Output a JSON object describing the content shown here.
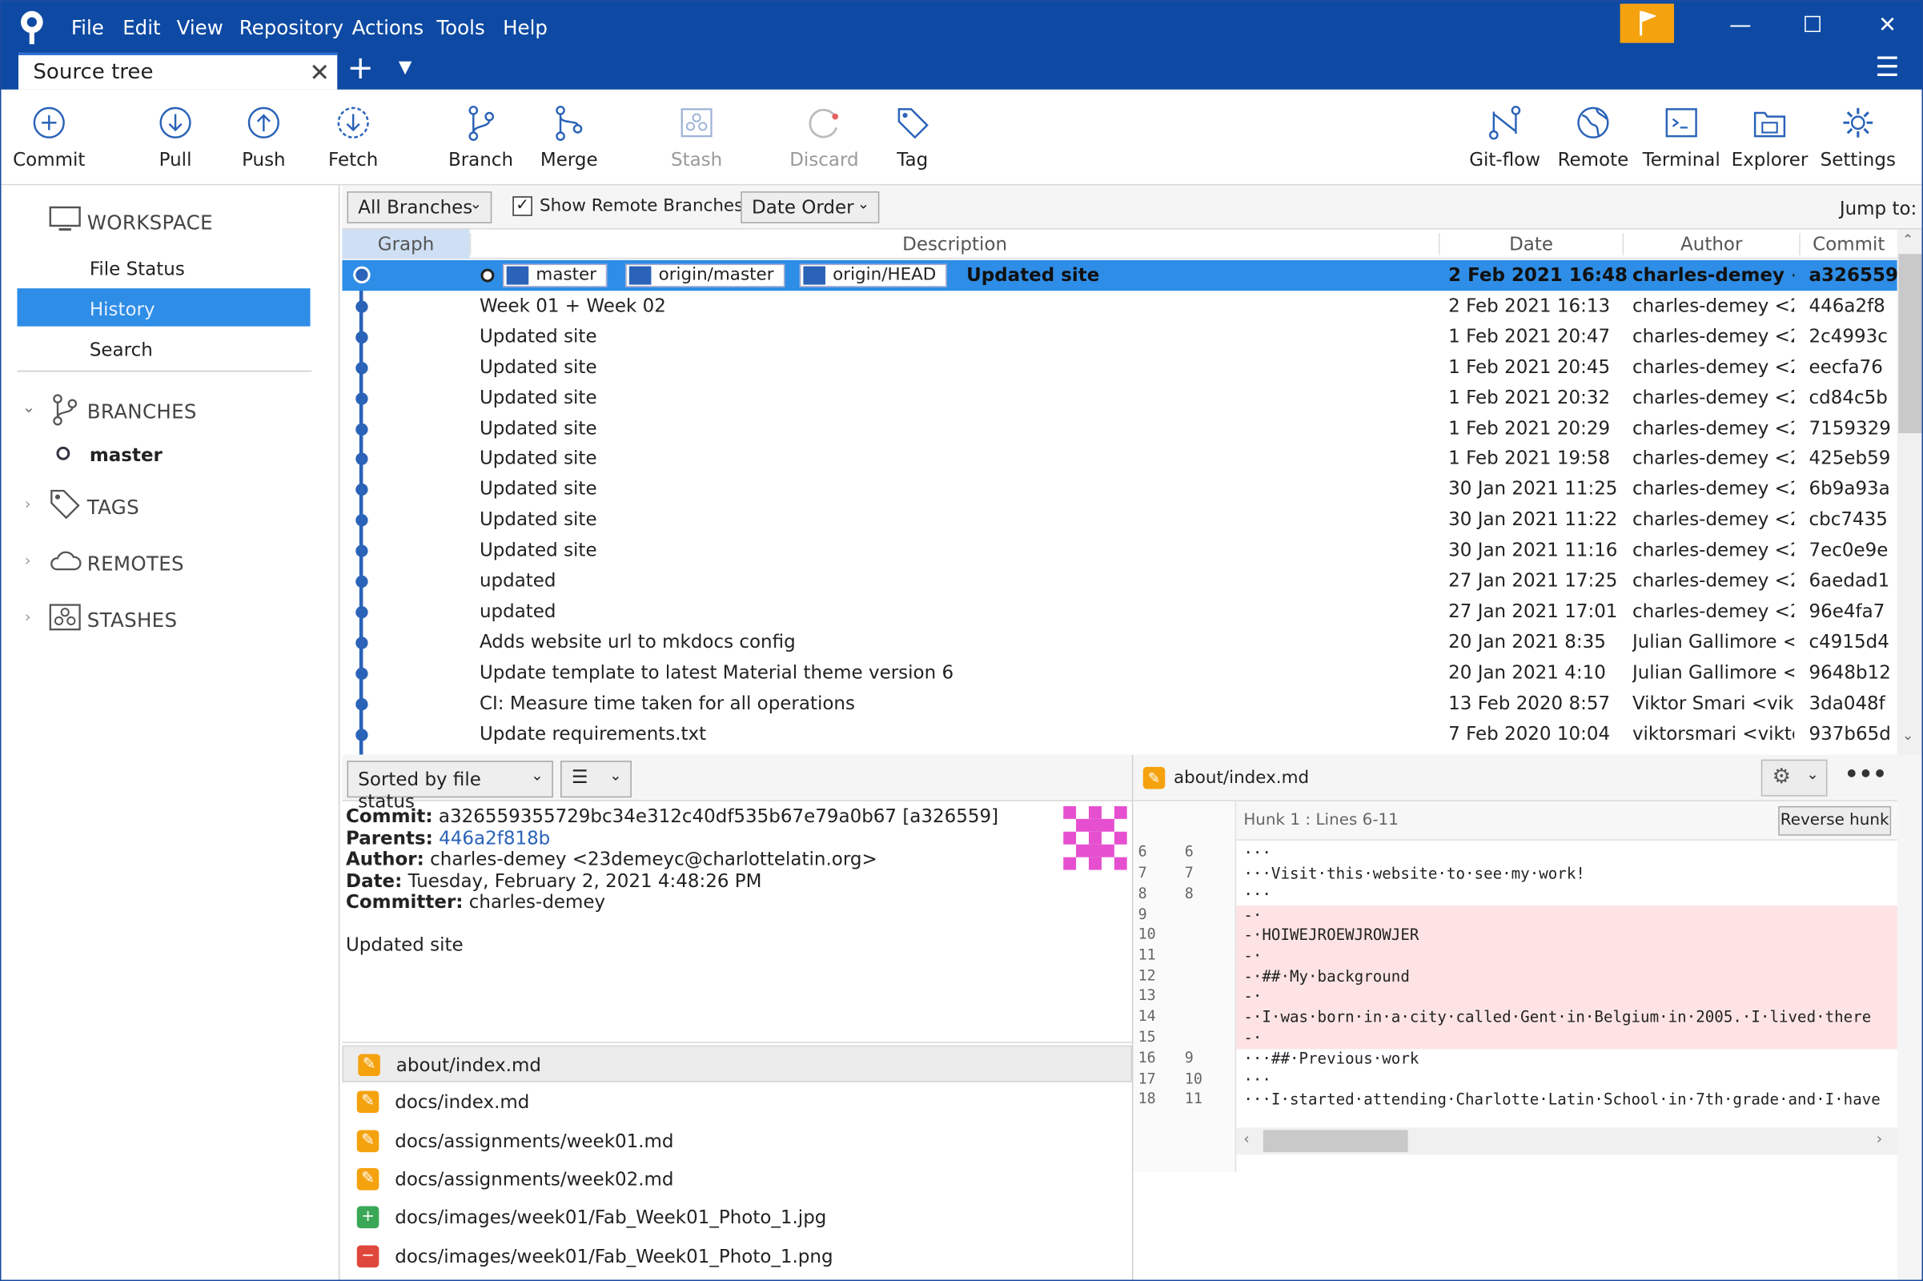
{
  "menu": [
    "File",
    "Edit",
    "View",
    "Repository",
    "Actions",
    "Tools",
    "Help"
  ],
  "tab": {
    "title": "Source tree"
  },
  "toolbar": {
    "left": [
      {
        "label": "Commit",
        "icon": "plus-circle-icon",
        "enabled": true
      },
      {
        "label": "Pull",
        "icon": "arrow-down-circle-icon",
        "enabled": true
      },
      {
        "label": "Push",
        "icon": "arrow-up-circle-icon",
        "enabled": true
      },
      {
        "label": "Fetch",
        "icon": "fetch-icon",
        "enabled": true
      },
      {
        "label": "Branch",
        "icon": "branch-icon",
        "enabled": true
      },
      {
        "label": "Merge",
        "icon": "merge-icon",
        "enabled": true
      },
      {
        "label": "Stash",
        "icon": "stash-icon",
        "enabled": false
      },
      {
        "label": "Discard",
        "icon": "discard-icon",
        "enabled": false
      },
      {
        "label": "Tag",
        "icon": "tag-icon",
        "enabled": true
      }
    ],
    "right": [
      {
        "label": "Git-flow",
        "icon": "git-flow-icon"
      },
      {
        "label": "Remote",
        "icon": "globe-icon"
      },
      {
        "label": "Terminal",
        "icon": "terminal-icon"
      },
      {
        "label": "Explorer",
        "icon": "explorer-icon"
      },
      {
        "label": "Settings",
        "icon": "gear-icon"
      }
    ]
  },
  "sidebar": {
    "workspace": "WORKSPACE",
    "file_status": "File Status",
    "history": "History",
    "search": "Search",
    "branches": "BRANCHES",
    "master": "master",
    "tags": "TAGS",
    "remotes": "REMOTES",
    "stashes": "STASHES"
  },
  "branchbar": {
    "branches_filter": "All Branches",
    "show_remote": "Show Remote Branches",
    "order": "Date Order",
    "jump_to": "Jump to:"
  },
  "columns": {
    "graph": "Graph",
    "description": "Description",
    "date": "Date",
    "author": "Author",
    "commit": "Commit"
  },
  "selected_refs": [
    "master",
    "origin/master",
    "origin/HEAD"
  ],
  "commits": [
    {
      "desc": "Updated site",
      "date": "2 Feb 2021 16:48",
      "author": "charles-demey <2",
      "hash": "a326559"
    },
    {
      "desc": "Week 01 + Week 02",
      "date": "2 Feb 2021 16:13",
      "author": "charles-demey <2",
      "hash": "446a2f8"
    },
    {
      "desc": "Updated site",
      "date": "1 Feb 2021 20:47",
      "author": "charles-demey <2",
      "hash": "2c4993c"
    },
    {
      "desc": "Updated site",
      "date": "1 Feb 2021 20:45",
      "author": "charles-demey <2",
      "hash": "eecfa76"
    },
    {
      "desc": "Updated site",
      "date": "1 Feb 2021 20:32",
      "author": "charles-demey <2",
      "hash": "cd84c5b"
    },
    {
      "desc": "Updated site",
      "date": "1 Feb 2021 20:29",
      "author": "charles-demey <2",
      "hash": "7159329"
    },
    {
      "desc": "Updated site",
      "date": "1 Feb 2021 19:58",
      "author": "charles-demey <2",
      "hash": "425eb59"
    },
    {
      "desc": "Updated site",
      "date": "30 Jan 2021 11:25",
      "author": "charles-demey <2",
      "hash": "6b9a93a"
    },
    {
      "desc": "Updated site",
      "date": "30 Jan 2021 11:22",
      "author": "charles-demey <2",
      "hash": "cbc7435"
    },
    {
      "desc": "Updated site",
      "date": "30 Jan 2021 11:16",
      "author": "charles-demey <2",
      "hash": "7ec0e9e"
    },
    {
      "desc": "updated",
      "date": "27 Jan 2021 17:25",
      "author": "charles-demey <2",
      "hash": "6aedad1"
    },
    {
      "desc": "updated",
      "date": "27 Jan 2021 17:01",
      "author": "charles-demey <2",
      "hash": "96e4fa7"
    },
    {
      "desc": "Adds website url to mkdocs config",
      "date": "20 Jan 2021 8:35",
      "author": "Julian Gallimore <j",
      "hash": "c4915d4"
    },
    {
      "desc": "Update template to latest Material theme version 6",
      "date": "20 Jan 2021 4:10",
      "author": "Julian Gallimore <j",
      "hash": "9648b12"
    },
    {
      "desc": "CI: Measure time taken for all operations",
      "date": "13 Feb 2020 8:57",
      "author": "Viktor Smari <vikto",
      "hash": "3da048f"
    },
    {
      "desc": "Update requirements.txt",
      "date": "7 Feb 2020 10:04",
      "author": "viktorsmari <viktor",
      "hash": "937b65d"
    }
  ],
  "sortbar": {
    "sort": "Sorted by file status"
  },
  "details": {
    "commit_label": "Commit:",
    "commit": "a326559355729bc34e312c40df535b67e79a0b67 [a326559]",
    "parents_label": "Parents:",
    "parents": "446a2f818b",
    "author_label": "Author:",
    "author": "charles-demey <23demeyc@charlottelatin.org>",
    "date_label": "Date:",
    "date": "Tuesday, February 2, 2021 4:48:26 PM",
    "committer_label": "Committer:",
    "committer": "charles-demey",
    "message": "Updated site"
  },
  "files": [
    {
      "name": "about/index.md",
      "status": "modified"
    },
    {
      "name": "docs/index.md",
      "status": "modified"
    },
    {
      "name": "docs/assignments/week01.md",
      "status": "modified"
    },
    {
      "name": "docs/assignments/week02.md",
      "status": "modified"
    },
    {
      "name": "docs/images/week01/Fab_Week01_Photo_1.jpg",
      "status": "added"
    },
    {
      "name": "docs/images/week01/Fab_Week01_Photo_1.png",
      "status": "removed"
    }
  ],
  "diff": {
    "file": "about/index.md",
    "hunk": "Hunk 1 : Lines 6-11",
    "reverse": "Reverse hunk",
    "lines": [
      {
        "old": "6",
        "new": "6",
        "text": "···",
        "type": "ctx"
      },
      {
        "old": "7",
        "new": "7",
        "text": "···Visit·this·website·to·see·my·work!",
        "type": "ctx"
      },
      {
        "old": "8",
        "new": "8",
        "text": "···",
        "type": "ctx"
      },
      {
        "old": "9",
        "new": "",
        "text": "-·",
        "type": "del"
      },
      {
        "old": "10",
        "new": "",
        "text": "-·HOIWEJROEWJROWJER",
        "type": "del"
      },
      {
        "old": "11",
        "new": "",
        "text": "-·",
        "type": "del"
      },
      {
        "old": "12",
        "new": "",
        "text": "-·##·My·background",
        "type": "del"
      },
      {
        "old": "13",
        "new": "",
        "text": "-·",
        "type": "del"
      },
      {
        "old": "14",
        "new": "",
        "text": "-·I·was·born·in·a·city·called·Gent·in·Belgium·in·2005.·I·lived·there",
        "type": "del"
      },
      {
        "old": "15",
        "new": "",
        "text": "-·",
        "type": "del"
      },
      {
        "old": "16",
        "new": "9",
        "text": "···##·Previous·work",
        "type": "ctx"
      },
      {
        "old": "17",
        "new": "10",
        "text": "···",
        "type": "ctx"
      },
      {
        "old": "18",
        "new": "11",
        "text": "···I·started·attending·Charlotte·Latin·School·in·7th·grade·and·I·have",
        "type": "ctx"
      }
    ]
  },
  "colors": {
    "titlebar": "#0e4aa3",
    "selection": "#2e8de6",
    "graph": "#2a63b8",
    "flag": "#f5a20f",
    "modified": "#f5a20f",
    "added": "#3aa757",
    "removed": "#e0473c"
  }
}
